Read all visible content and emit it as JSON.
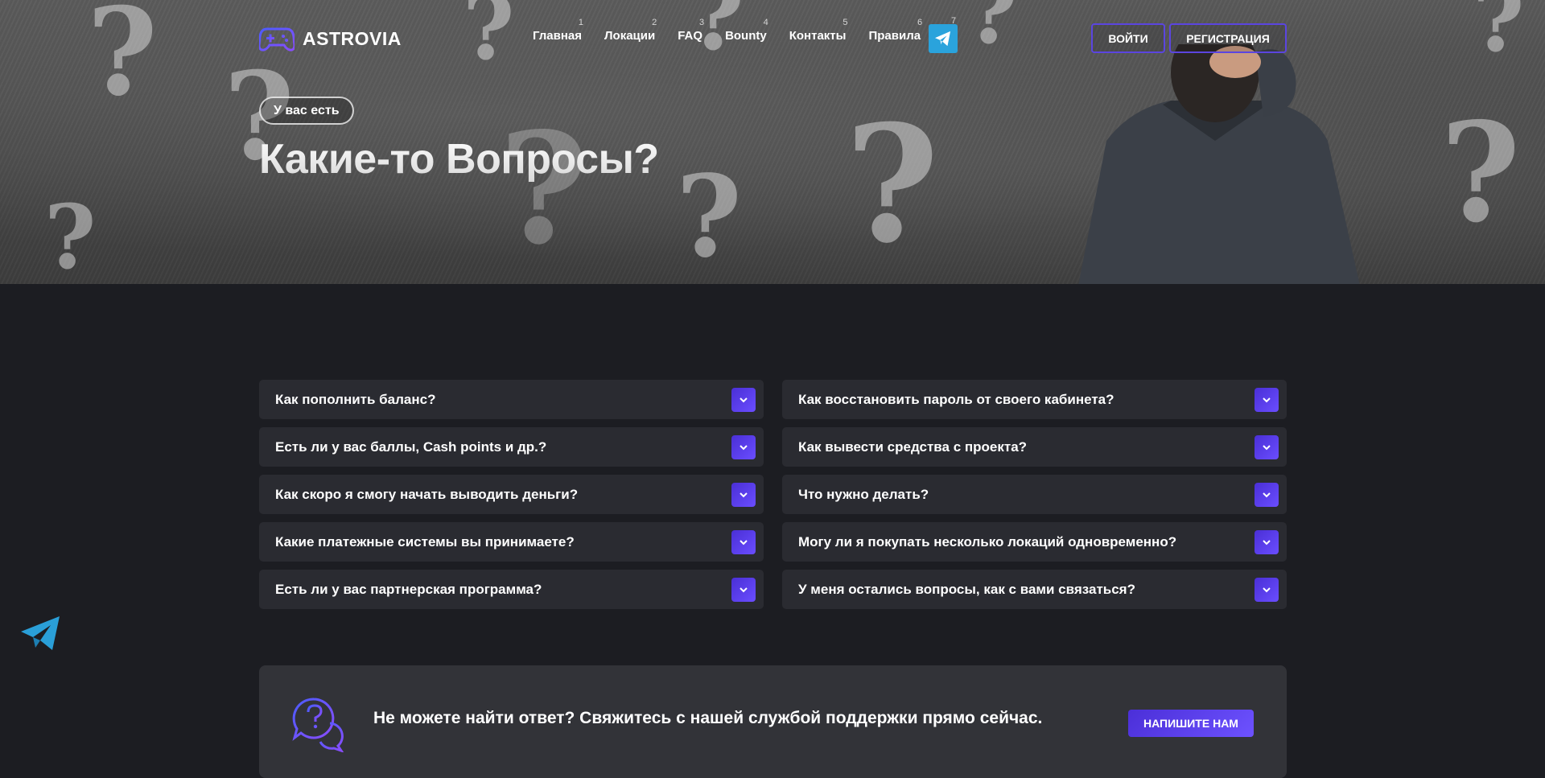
{
  "brand": {
    "name": "ASTROVIA"
  },
  "nav": {
    "items": [
      {
        "num": "1",
        "label": "Главная"
      },
      {
        "num": "2",
        "label": "Локации"
      },
      {
        "num": "3",
        "label": "FAQ"
      },
      {
        "num": "4",
        "label": "Bounty"
      },
      {
        "num": "5",
        "label": "Контакты"
      },
      {
        "num": "6",
        "label": "Правила"
      }
    ],
    "telegram_num": "7"
  },
  "auth": {
    "login": "ВОЙТИ",
    "register": "РЕГИСТРАЦИЯ"
  },
  "hero": {
    "pill": "У вас есть",
    "title": "Какие-то Вопросы?"
  },
  "faq": {
    "left": [
      "Как пополнить баланс?",
      "Есть ли у вас баллы, Cash points и др.?",
      "Как скоро я смогу начать выводить деньги?",
      "Какие платежные системы вы принимаете?",
      "Есть ли у вас партнерская программа?"
    ],
    "right": [
      "Как восстановить пароль от своего кабинета?",
      "Как вывести средства с проекта?",
      "Что нужно делать?",
      "Могу ли я покупать несколько локаций одновременно?",
      "У меня остались вопросы, как с вами связаться?"
    ]
  },
  "support": {
    "text": "Не можете найти ответ? Свяжитесь с нашей службой поддержки прямо сейчас.",
    "button": "НАПИШИТЕ НАМ"
  },
  "colors": {
    "accent": "#5b45e0",
    "accent_light": "#6d52ff",
    "telegram": "#2aa3dc",
    "background": "#1c1d22",
    "card": "#2a2b31"
  },
  "icons": {
    "logo": "gamepad-icon",
    "telegram": "telegram-plane-icon",
    "toggle": "chevron-down-icon",
    "support": "question-chat-icon"
  }
}
